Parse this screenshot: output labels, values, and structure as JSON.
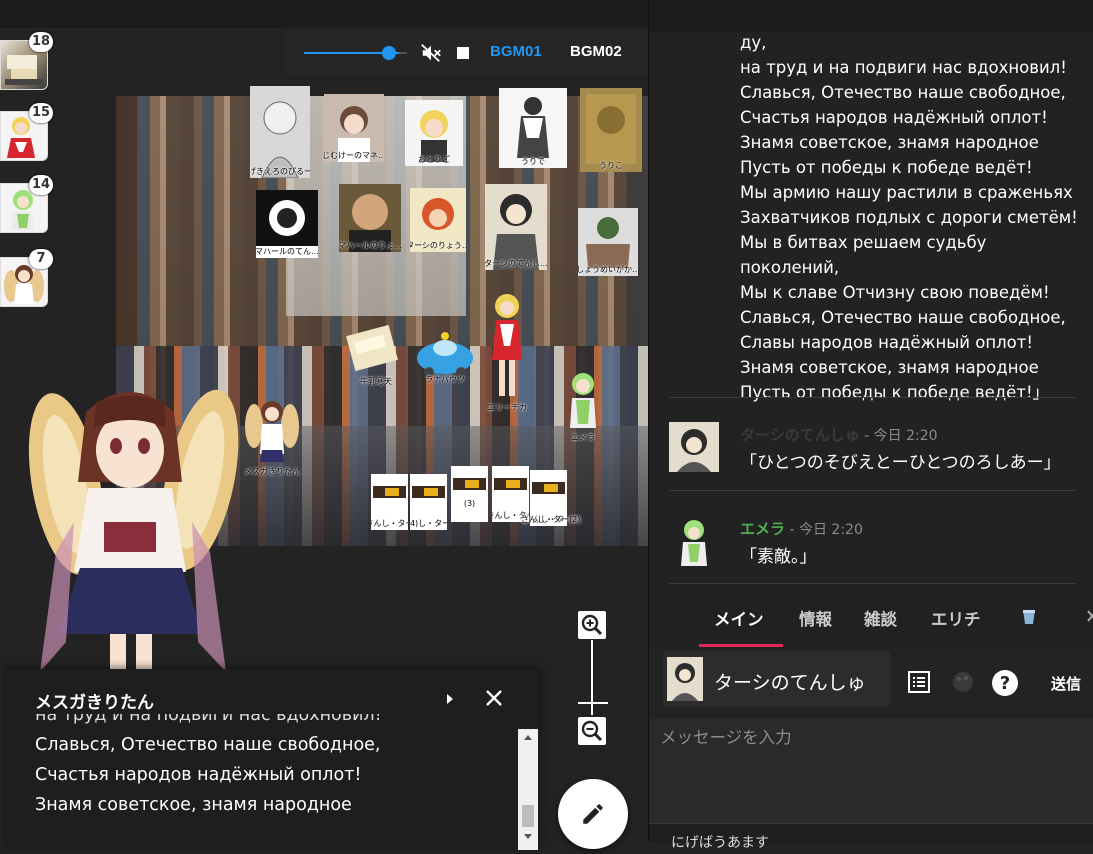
{
  "inventory": [
    {
      "count": "18",
      "icon": "sweets-thumb"
    },
    {
      "count": "15",
      "icon": "blonde-girl-thumb"
    },
    {
      "count": "14",
      "icon": "green-hair-girl-thumb"
    },
    {
      "count": "7",
      "icon": "brown-hair-girl-thumb"
    }
  ],
  "audio": {
    "bgm1": "BGM01",
    "bgm2": "BGM02",
    "active_color": "#2196f3",
    "volume_fraction": 0.8
  },
  "stage": {
    "pieces": [
      {
        "id": "p1",
        "label": "げきえろのぴるー"
      },
      {
        "id": "p2",
        "label": "じむけーのマネ…"
      },
      {
        "id": "p3",
        "label": "おとりご"
      },
      {
        "id": "p4",
        "label": "うりで"
      },
      {
        "id": "p5",
        "label": "うりこ"
      },
      {
        "id": "p6",
        "label": "マハールのてん…"
      },
      {
        "id": "p7",
        "label": "マハールのりょ…"
      },
      {
        "id": "p8",
        "label": "ターシのりょう…"
      },
      {
        "id": "p9",
        "label": "ターシのてんし…"
      },
      {
        "id": "p10",
        "label": "しょうめいがか…"
      },
      {
        "id": "p11",
        "label": "牛乳寒天"
      },
      {
        "id": "p12",
        "label": "ラナパウツ"
      },
      {
        "id": "p13",
        "label": "エリーチカ"
      },
      {
        "id": "p14",
        "label": "エメラ"
      },
      {
        "id": "p15",
        "label": "メスガきりたん"
      },
      {
        "id": "p16",
        "label": "さんし・ター"
      },
      {
        "id": "p17",
        "label": "(4)し・ター"
      },
      {
        "id": "p18",
        "label": "(3)"
      },
      {
        "id": "p19",
        "label": "さんし・ター"
      },
      {
        "id": "p20",
        "label": "さんし・ター"
      },
      {
        "id": "p21",
        "label": "さんし・ター(2)"
      }
    ]
  },
  "zoom": {
    "in_icon": "zoom-in-icon",
    "out_icon": "zoom-out-icon"
  },
  "panel": {
    "title": "メスガきりたん",
    "lines": [
      "на труд и на подвиги нас вдохновил!",
      "Славься, Отечество наше свободное,",
      "Счастья народов надёжный оплот!",
      "Знамя советское, знамя народное"
    ]
  },
  "log": {
    "verse": [
      "ду,",
      "на труд и на подвиги нас вдохновил!",
      "Славься, Отечество наше свободное,",
      "Счастья народов надёжный оплот!",
      "Знамя советское, знамя народное",
      "Пусть от победы к победе ведёт!",
      "Мы армию нашу растили в сраженьях",
      "Захватчиков подлых с дороги сметём!",
      "Мы в битвах решаем судьбу поколений,",
      "Мы к славе Отчизну свою поведём!",
      "Славься, Отечество наше свободное,",
      "Славы народов надёжный оплот!",
      "Знамя советское, знамя народное",
      "Пусть от победы к победе ведёт!」"
    ],
    "messages": [
      {
        "name": "ターシのてんしゅ",
        "time": " - 今日 2:20",
        "text": "「ひとつのそびえとーひとつのろしあー」",
        "name_color": "#3a3a3a"
      },
      {
        "name": "エメラ",
        "time": " - 今日 2:20",
        "text": "「素敵。」",
        "name_color": "#4caf50"
      }
    ]
  },
  "tabs": [
    "メイン",
    "情報",
    "雑談",
    "エリチ"
  ],
  "tab_accent": "#e0265a",
  "input": {
    "character": "ターシのてんしゅ",
    "send_label": "送信",
    "placeholder": "メッセージを入力",
    "bottom_text": "にげばうあます"
  }
}
